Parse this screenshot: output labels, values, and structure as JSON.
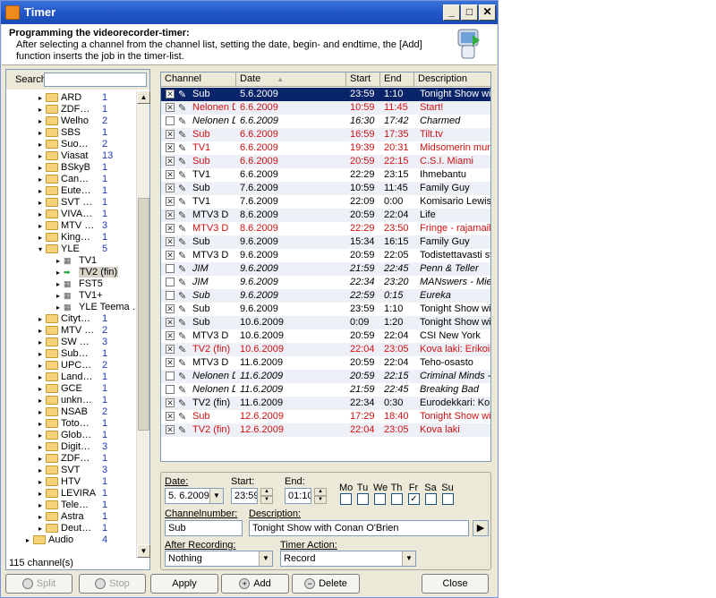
{
  "window": {
    "title": "Timer"
  },
  "header": {
    "title": "Programming the videorecorder-timer:",
    "description": "After selecting a channel from the channel list, setting the date, begin- and endtime, the [Add] function inserts the job in the timer-list."
  },
  "tree": {
    "search_label": "Search",
    "search_value": "",
    "status": "115 channel(s)",
    "nodes": [
      {
        "label": "ARD",
        "count": "1",
        "level": 1,
        "type": "folder"
      },
      {
        "label": "ZDF…",
        "count": "1",
        "level": 1,
        "type": "folder"
      },
      {
        "label": "Welho",
        "count": "2",
        "level": 1,
        "type": "folder"
      },
      {
        "label": "SBS",
        "count": "1",
        "level": 1,
        "type": "folder"
      },
      {
        "label": "Suo…",
        "count": "2",
        "level": 1,
        "type": "folder"
      },
      {
        "label": "Viasat",
        "count": "13",
        "level": 1,
        "type": "folder"
      },
      {
        "label": "BSkyB",
        "count": "1",
        "level": 1,
        "type": "folder"
      },
      {
        "label": "Can…",
        "count": "1",
        "level": 1,
        "type": "folder"
      },
      {
        "label": "Eute…",
        "count": "1",
        "level": 1,
        "type": "folder"
      },
      {
        "label": "SVT …",
        "count": "1",
        "level": 1,
        "type": "folder"
      },
      {
        "label": "VIVA…",
        "count": "1",
        "level": 1,
        "type": "folder"
      },
      {
        "label": "MTV …",
        "count": "3",
        "level": 1,
        "type": "folder"
      },
      {
        "label": "King…",
        "count": "1",
        "level": 1,
        "type": "folder"
      },
      {
        "label": "YLE",
        "count": "5",
        "level": 1,
        "type": "folder-open"
      },
      {
        "label": "TV1",
        "count": "",
        "level": 2,
        "type": "channel"
      },
      {
        "label": "TV2 (fin)",
        "count": "",
        "level": 2,
        "type": "channel-selected"
      },
      {
        "label": "FST5",
        "count": "",
        "level": 2,
        "type": "channel"
      },
      {
        "label": "TV1+",
        "count": "",
        "level": 2,
        "type": "channel"
      },
      {
        "label": "YLE Teema …",
        "count": "",
        "level": 2,
        "type": "channel"
      },
      {
        "label": "Cityt…",
        "count": "1",
        "level": 1,
        "type": "folder"
      },
      {
        "label": "MTV …",
        "count": "2",
        "level": 1,
        "type": "folder"
      },
      {
        "label": "SW …",
        "count": "3",
        "level": 1,
        "type": "folder"
      },
      {
        "label": "Sub…",
        "count": "1",
        "level": 1,
        "type": "folder"
      },
      {
        "label": "UPC…",
        "count": "2",
        "level": 1,
        "type": "folder"
      },
      {
        "label": "Land…",
        "count": "1",
        "level": 1,
        "type": "folder"
      },
      {
        "label": "GCE",
        "count": "1",
        "level": 1,
        "type": "folder"
      },
      {
        "label": "unkn…",
        "count": "1",
        "level": 1,
        "type": "folder"
      },
      {
        "label": "NSAB",
        "count": "2",
        "level": 1,
        "type": "folder"
      },
      {
        "label": "Toto…",
        "count": "1",
        "level": 1,
        "type": "folder"
      },
      {
        "label": "Glob…",
        "count": "1",
        "level": 1,
        "type": "folder"
      },
      {
        "label": "Digit…",
        "count": "3",
        "level": 1,
        "type": "folder"
      },
      {
        "label": "ZDF…",
        "count": "1",
        "level": 1,
        "type": "folder"
      },
      {
        "label": "SVT",
        "count": "3",
        "level": 1,
        "type": "folder"
      },
      {
        "label": "HTV",
        "count": "1",
        "level": 1,
        "type": "folder"
      },
      {
        "label": "LEVIRA",
        "count": "1",
        "level": 1,
        "type": "folder"
      },
      {
        "label": "Tele…",
        "count": "1",
        "level": 1,
        "type": "folder"
      },
      {
        "label": "Astra",
        "count": "1",
        "level": 1,
        "type": "folder"
      },
      {
        "label": "Deut…",
        "count": "1",
        "level": 1,
        "type": "folder"
      },
      {
        "label": "Audio",
        "count": "4",
        "level": 0,
        "type": "folder"
      }
    ]
  },
  "grid": {
    "columns": [
      "Channel",
      "Date",
      "Start",
      "End",
      "Description"
    ],
    "rows": [
      {
        "checked": true,
        "channel": "Sub",
        "date": "5.6.2009",
        "start": "23:59",
        "end": "1:10",
        "desc": "Tonight Show with",
        "style": "sel"
      },
      {
        "checked": true,
        "channel": "Nelonen D",
        "date": "6.6.2009",
        "start": "10:59",
        "end": "11:45",
        "desc": "Start!",
        "style": "red"
      },
      {
        "checked": false,
        "channel": "Nelonen D",
        "date": "6.6.2009",
        "start": "16:30",
        "end": "17:42",
        "desc": "Charmed",
        "style": "italic"
      },
      {
        "checked": true,
        "channel": "Sub",
        "date": "6.6.2009",
        "start": "16:59",
        "end": "17:35",
        "desc": "Tilt.tv",
        "style": "red"
      },
      {
        "checked": true,
        "channel": "TV1",
        "date": "6.6.2009",
        "start": "19:39",
        "end": "20:31",
        "desc": "Midsomerin murhat",
        "style": "red"
      },
      {
        "checked": true,
        "channel": "Sub",
        "date": "6.6.2009",
        "start": "20:59",
        "end": "22:15",
        "desc": "C.S.I. Miami",
        "style": "red"
      },
      {
        "checked": true,
        "channel": "TV1",
        "date": "6.6.2009",
        "start": "22:29",
        "end": "23:15",
        "desc": "Ihmebantu",
        "style": "normal"
      },
      {
        "checked": true,
        "channel": "Sub",
        "date": "7.6.2009",
        "start": "10:59",
        "end": "11:45",
        "desc": "Family Guy",
        "style": "normal"
      },
      {
        "checked": true,
        "channel": "TV1",
        "date": "7.6.2009",
        "start": "22:09",
        "end": "0:00",
        "desc": "Komisario Lewis",
        "style": "normal"
      },
      {
        "checked": true,
        "channel": "MTV3 D",
        "date": "8.6.2009",
        "start": "20:59",
        "end": "22:04",
        "desc": "Life",
        "style": "normal"
      },
      {
        "checked": true,
        "channel": "MTV3 D",
        "date": "8.6.2009",
        "start": "22:29",
        "end": "23:50",
        "desc": "Fringe - rajamailla",
        "style": "red"
      },
      {
        "checked": true,
        "channel": "Sub",
        "date": "9.6.2009",
        "start": "15:34",
        "end": "16:15",
        "desc": "Family Guy",
        "style": "normal"
      },
      {
        "checked": true,
        "channel": "MTV3 D",
        "date": "9.6.2009",
        "start": "20:59",
        "end": "22:05",
        "desc": "Todistettavasti syyl…",
        "style": "normal"
      },
      {
        "checked": false,
        "channel": "JIM",
        "date": "9.6.2009",
        "start": "21:59",
        "end": "22:45",
        "desc": "Penn & Teller",
        "style": "italic"
      },
      {
        "checked": false,
        "channel": "JIM",
        "date": "9.6.2009",
        "start": "22:34",
        "end": "23:20",
        "desc": "MANswers - Miehin…",
        "style": "italic"
      },
      {
        "checked": false,
        "channel": "Sub",
        "date": "9.6.2009",
        "start": "22:59",
        "end": "0:15",
        "desc": "Eureka",
        "style": "italic"
      },
      {
        "checked": true,
        "channel": "Sub",
        "date": "9.6.2009",
        "start": "23:59",
        "end": "1:10",
        "desc": "Tonight Show with …",
        "style": "normal"
      },
      {
        "checked": true,
        "channel": "Sub",
        "date": "10.6.2009",
        "start": "0:09",
        "end": "1:20",
        "desc": "Tonight Show with …",
        "style": "normal"
      },
      {
        "checked": true,
        "channel": "MTV3 D",
        "date": "10.6.2009",
        "start": "20:59",
        "end": "22:04",
        "desc": "CSI New York",
        "style": "normal"
      },
      {
        "checked": true,
        "channel": "TV2 (fin)",
        "date": "10.6.2009",
        "start": "22:04",
        "end": "23:05",
        "desc": "Kova laki: Erikoisyks",
        "style": "red"
      },
      {
        "checked": true,
        "channel": "MTV3 D",
        "date": "11.6.2009",
        "start": "20:59",
        "end": "22:04",
        "desc": "Teho-osasto",
        "style": "normal"
      },
      {
        "checked": false,
        "channel": "Nelonen D",
        "date": "11.6.2009",
        "start": "20:59",
        "end": "22:15",
        "desc": "Criminal Minds - FBI…",
        "style": "italic"
      },
      {
        "checked": false,
        "channel": "Nelonen D",
        "date": "11.6.2009",
        "start": "21:59",
        "end": "22:45",
        "desc": "Breaking Bad",
        "style": "italic"
      },
      {
        "checked": true,
        "channel": "TV2 (fin)",
        "date": "11.6.2009",
        "start": "22:34",
        "end": "0:30",
        "desc": "Eurodekkari: Komis…",
        "style": "normal"
      },
      {
        "checked": true,
        "channel": "Sub",
        "date": "12.6.2009",
        "start": "17:29",
        "end": "18:40",
        "desc": "Tonight Show with …",
        "style": "red"
      },
      {
        "checked": true,
        "channel": "TV2 (fin)",
        "date": "12.6.2009",
        "start": "22:04",
        "end": "23:05",
        "desc": "Kova laki",
        "style": "red"
      }
    ]
  },
  "form": {
    "date_label": "Date:",
    "date_value": "5. 6.2009",
    "start_label": "Start:",
    "start_value": "23:59",
    "end_label": "End:",
    "end_value": "01:10",
    "days": [
      {
        "label": "Mo",
        "checked": false
      },
      {
        "label": "Tu",
        "checked": false
      },
      {
        "label": "We",
        "checked": false
      },
      {
        "label": "Th",
        "checked": false
      },
      {
        "label": "Fr",
        "checked": true
      },
      {
        "label": "Sa",
        "checked": false
      },
      {
        "label": "Su",
        "checked": false
      }
    ],
    "channelnumber_label": "Channelnumber:",
    "channelnumber_value": "Sub",
    "description_label": "Description:",
    "description_value": "Tonight Show with Conan O'Brien",
    "after_label": "After Recording:",
    "after_value": "Nothing",
    "action_label": "Timer Action:",
    "action_value": "Record"
  },
  "buttons": {
    "split": "Split",
    "stop": "Stop",
    "apply": "Apply",
    "add": "Add",
    "delete": "Delete",
    "close": "Close"
  },
  "colors": {
    "selected_row": "#0a246a",
    "conflict_text": "#d01010",
    "titlebar": "#1f55c6"
  }
}
